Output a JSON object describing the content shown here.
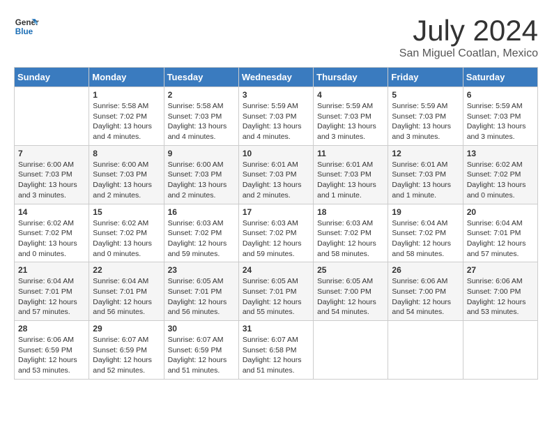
{
  "logo": {
    "line1": "General",
    "line2": "Blue"
  },
  "title": "July 2024",
  "subtitle": "San Miguel Coatlan, Mexico",
  "days_header": [
    "Sunday",
    "Monday",
    "Tuesday",
    "Wednesday",
    "Thursday",
    "Friday",
    "Saturday"
  ],
  "weeks": [
    [
      {
        "day": "",
        "content": ""
      },
      {
        "day": "1",
        "content": "Sunrise: 5:58 AM\nSunset: 7:02 PM\nDaylight: 13 hours\nand 4 minutes."
      },
      {
        "day": "2",
        "content": "Sunrise: 5:58 AM\nSunset: 7:03 PM\nDaylight: 13 hours\nand 4 minutes."
      },
      {
        "day": "3",
        "content": "Sunrise: 5:59 AM\nSunset: 7:03 PM\nDaylight: 13 hours\nand 4 minutes."
      },
      {
        "day": "4",
        "content": "Sunrise: 5:59 AM\nSunset: 7:03 PM\nDaylight: 13 hours\nand 3 minutes."
      },
      {
        "day": "5",
        "content": "Sunrise: 5:59 AM\nSunset: 7:03 PM\nDaylight: 13 hours\nand 3 minutes."
      },
      {
        "day": "6",
        "content": "Sunrise: 5:59 AM\nSunset: 7:03 PM\nDaylight: 13 hours\nand 3 minutes."
      }
    ],
    [
      {
        "day": "7",
        "content": "Sunrise: 6:00 AM\nSunset: 7:03 PM\nDaylight: 13 hours\nand 3 minutes."
      },
      {
        "day": "8",
        "content": "Sunrise: 6:00 AM\nSunset: 7:03 PM\nDaylight: 13 hours\nand 2 minutes."
      },
      {
        "day": "9",
        "content": "Sunrise: 6:00 AM\nSunset: 7:03 PM\nDaylight: 13 hours\nand 2 minutes."
      },
      {
        "day": "10",
        "content": "Sunrise: 6:01 AM\nSunset: 7:03 PM\nDaylight: 13 hours\nand 2 minutes."
      },
      {
        "day": "11",
        "content": "Sunrise: 6:01 AM\nSunset: 7:03 PM\nDaylight: 13 hours\nand 1 minute."
      },
      {
        "day": "12",
        "content": "Sunrise: 6:01 AM\nSunset: 7:03 PM\nDaylight: 13 hours\nand 1 minute."
      },
      {
        "day": "13",
        "content": "Sunrise: 6:02 AM\nSunset: 7:02 PM\nDaylight: 13 hours\nand 0 minutes."
      }
    ],
    [
      {
        "day": "14",
        "content": "Sunrise: 6:02 AM\nSunset: 7:02 PM\nDaylight: 13 hours\nand 0 minutes."
      },
      {
        "day": "15",
        "content": "Sunrise: 6:02 AM\nSunset: 7:02 PM\nDaylight: 13 hours\nand 0 minutes."
      },
      {
        "day": "16",
        "content": "Sunrise: 6:03 AM\nSunset: 7:02 PM\nDaylight: 12 hours\nand 59 minutes."
      },
      {
        "day": "17",
        "content": "Sunrise: 6:03 AM\nSunset: 7:02 PM\nDaylight: 12 hours\nand 59 minutes."
      },
      {
        "day": "18",
        "content": "Sunrise: 6:03 AM\nSunset: 7:02 PM\nDaylight: 12 hours\nand 58 minutes."
      },
      {
        "day": "19",
        "content": "Sunrise: 6:04 AM\nSunset: 7:02 PM\nDaylight: 12 hours\nand 58 minutes."
      },
      {
        "day": "20",
        "content": "Sunrise: 6:04 AM\nSunset: 7:01 PM\nDaylight: 12 hours\nand 57 minutes."
      }
    ],
    [
      {
        "day": "21",
        "content": "Sunrise: 6:04 AM\nSunset: 7:01 PM\nDaylight: 12 hours\nand 57 minutes."
      },
      {
        "day": "22",
        "content": "Sunrise: 6:04 AM\nSunset: 7:01 PM\nDaylight: 12 hours\nand 56 minutes."
      },
      {
        "day": "23",
        "content": "Sunrise: 6:05 AM\nSunset: 7:01 PM\nDaylight: 12 hours\nand 56 minutes."
      },
      {
        "day": "24",
        "content": "Sunrise: 6:05 AM\nSunset: 7:01 PM\nDaylight: 12 hours\nand 55 minutes."
      },
      {
        "day": "25",
        "content": "Sunrise: 6:05 AM\nSunset: 7:00 PM\nDaylight: 12 hours\nand 54 minutes."
      },
      {
        "day": "26",
        "content": "Sunrise: 6:06 AM\nSunset: 7:00 PM\nDaylight: 12 hours\nand 54 minutes."
      },
      {
        "day": "27",
        "content": "Sunrise: 6:06 AM\nSunset: 7:00 PM\nDaylight: 12 hours\nand 53 minutes."
      }
    ],
    [
      {
        "day": "28",
        "content": "Sunrise: 6:06 AM\nSunset: 6:59 PM\nDaylight: 12 hours\nand 53 minutes."
      },
      {
        "day": "29",
        "content": "Sunrise: 6:07 AM\nSunset: 6:59 PM\nDaylight: 12 hours\nand 52 minutes."
      },
      {
        "day": "30",
        "content": "Sunrise: 6:07 AM\nSunset: 6:59 PM\nDaylight: 12 hours\nand 51 minutes."
      },
      {
        "day": "31",
        "content": "Sunrise: 6:07 AM\nSunset: 6:58 PM\nDaylight: 12 hours\nand 51 minutes."
      },
      {
        "day": "",
        "content": ""
      },
      {
        "day": "",
        "content": ""
      },
      {
        "day": "",
        "content": ""
      }
    ]
  ]
}
